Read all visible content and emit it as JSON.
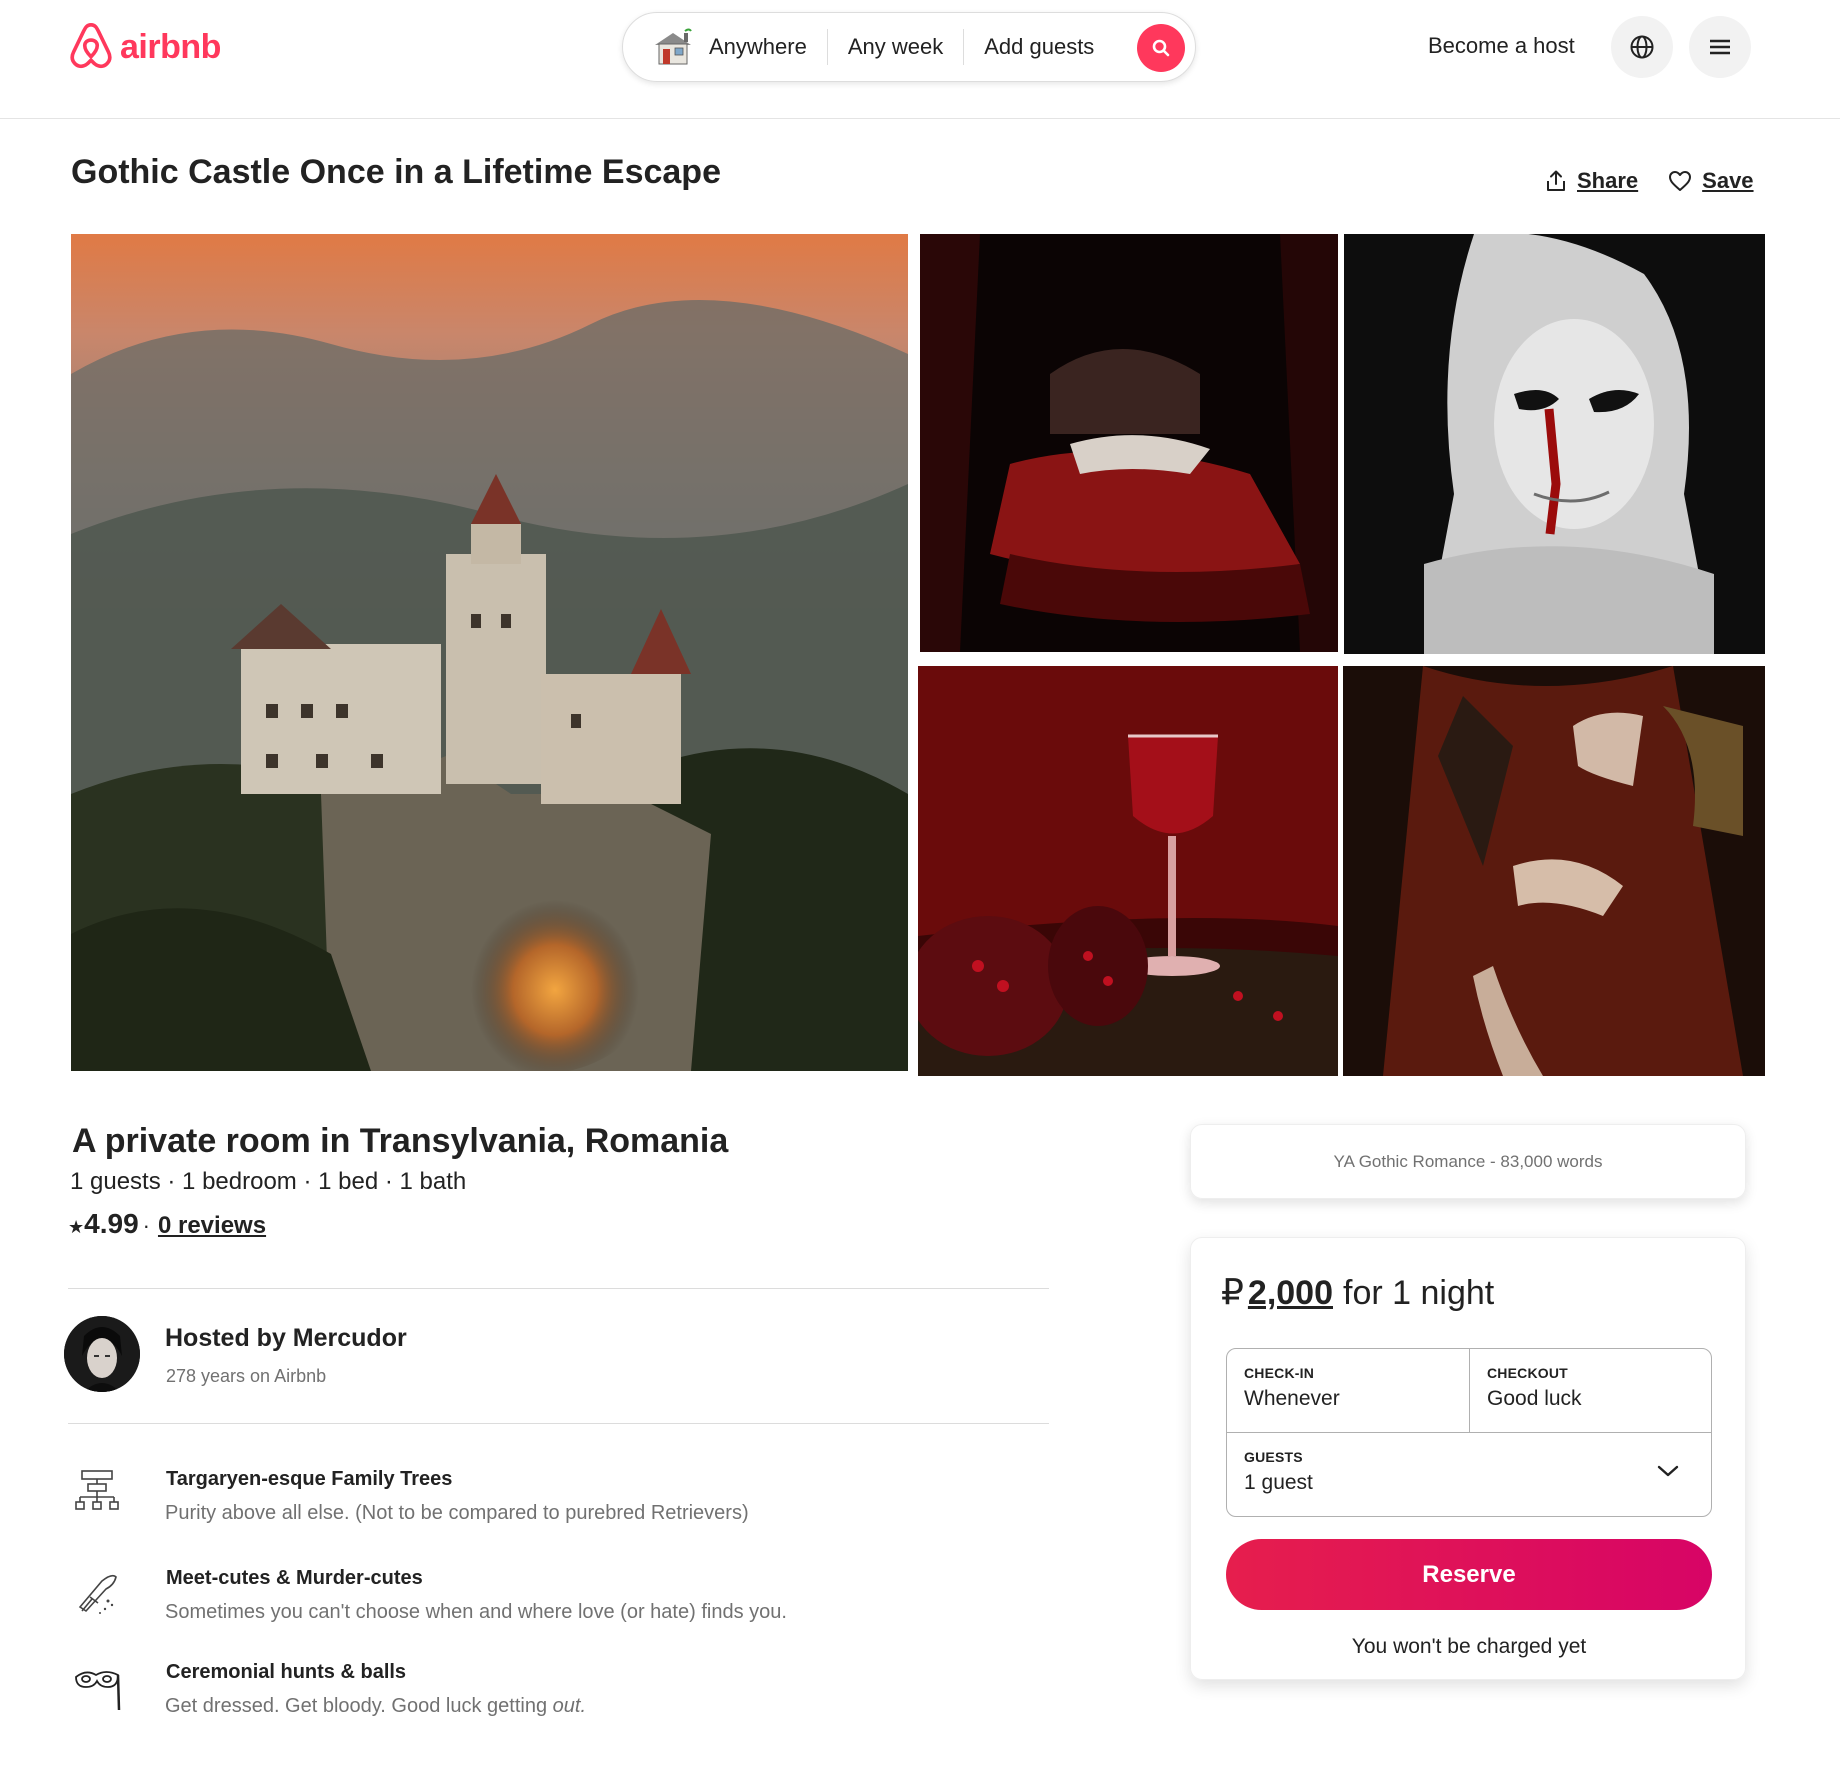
{
  "header": {
    "logo_text": "airbnb",
    "search": {
      "location": "Anywhere",
      "dates": "Any week",
      "guests": "Add guests"
    },
    "become_host": "Become a host"
  },
  "listing": {
    "title": "Gothic Castle Once in a Lifetime Escape",
    "share_label": "Share",
    "save_label": "Save",
    "subtitle": "A private room in Transylvania, Romania",
    "specs": "1 guests · 1 bedroom · 1 bed · 1 bath",
    "rating": "4.99",
    "reviews": "0 reviews"
  },
  "host": {
    "name": "Hosted by Mercudor",
    "years": "278 years on Airbnb"
  },
  "features": [
    {
      "title": "Targaryen-esque Family Trees",
      "description": "Purity above all else. (Not to be compared to purebred Retrievers)",
      "icon": "family-tree-icon"
    },
    {
      "title": "Meet-cutes & Murder-cutes",
      "description": "Sometimes you can't choose when and where love (or hate) finds you.",
      "desc_italic": "",
      "icon": "knife-icon"
    },
    {
      "title": "Ceremonial hunts & balls",
      "description": "Get dressed. Get bloody. Good luck getting ",
      "desc_italic": "out.",
      "icon": "masquerade-mask-icon"
    }
  ],
  "booking": {
    "genre": "YA Gothic Romance - 83,000 words",
    "currency_symbol": "₽",
    "amount": "2,000",
    "per_night": "for 1 night",
    "checkin_label": "CHECK-IN",
    "checkin_value": "Whenever",
    "checkout_label": "CHECKOUT",
    "checkout_value": "Good luck",
    "guests_label": "GUESTS",
    "guests_value": "1 guest",
    "reserve_label": "Reserve",
    "no_charge_note": "You won't be charged yet"
  },
  "colors": {
    "brand": "#FF385C",
    "reserve_start": "#E61E4D",
    "reserve_end": "#D70466",
    "muted_text": "#717171"
  }
}
